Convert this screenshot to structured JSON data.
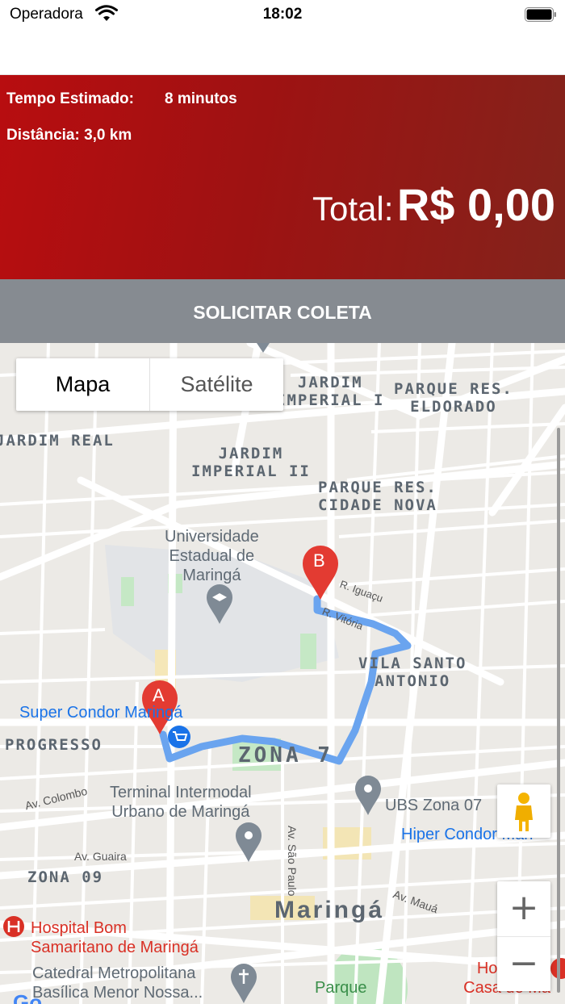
{
  "status_bar": {
    "carrier": "Operadora",
    "time": "18:02"
  },
  "trip": {
    "eta_label": "Tempo Estimado:",
    "eta_value": "8 minutos",
    "distance": "Distância: 3,0 km",
    "total_label": "Total:",
    "total_value": "R$ 0,00"
  },
  "request_button": "SOLICITAR COLETA",
  "map": {
    "type_toggle": {
      "map": "Mapa",
      "satellite": "Satélite",
      "selected": "Mapa"
    },
    "markers": {
      "origin": "A",
      "destination": "B"
    },
    "areas": {
      "jardim_imperial_i": "JARDIM\nIMPERIAL I",
      "parque_eldorado": "PARQUE RES.\nELDORADO",
      "jardim_real": "JARDIM REAL",
      "jardim_imperial_ii": "JARDIM\nIMPERIAL II",
      "parque_cidade_nova": "PARQUE RES.\nCIDADE NOVA",
      "vila_santo_antonio": "VILA SANTO\nANTONIO",
      "progresso": "PROGRESSO",
      "zona_7": "ZONA 7",
      "zona_09": "ZONA 09",
      "city": "Maringá"
    },
    "pois": {
      "university": "Universidade\nEstadual de\nMaringá",
      "super_condor": "Super Condor Maringá",
      "terminal": "Terminal Intermodal\nUrbano de Maringá",
      "ubs": "UBS Zona 07",
      "hiper_condor": "Hiper Condor Mari",
      "hospital_bom_samaritano": "Hospital Bom\nSamaritano de Maringá",
      "catedral": "Catedral Metropolitana\nBasílica Menor Nossa...",
      "parque": "Parque",
      "hospital_right": "Hospital S\nCasa de Ma"
    },
    "streets": {
      "iguacu": "R. Iguaçu",
      "vitoria": "R. Vitória",
      "colombo": "Av. Colombo",
      "guaira": "Av. Guaira",
      "sao_paulo": "Av. São Paulo",
      "maua": "Av. Mauá"
    },
    "zoom_in": "+",
    "zoom_out": "−",
    "colors": {
      "route": "#6aa4ef",
      "marker": "#e33b32",
      "poi_blue": "#1a73e8",
      "hospital": "#d93025"
    }
  },
  "theme": {
    "header_red": "#a81010",
    "button_gray": "#868b91"
  }
}
